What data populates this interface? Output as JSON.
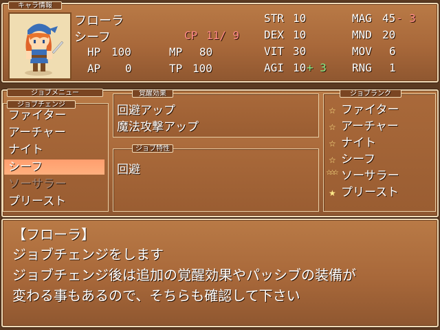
{
  "status": {
    "tab": "キャラ情報",
    "name": "フローラ",
    "job": "シーフ",
    "cp_label": "CP",
    "cp_value": "11/ 9",
    "hp_label": "HP",
    "hp": "100",
    "mp_label": "MP",
    "mp": "80",
    "ap_label": "AP",
    "ap": "0",
    "tp_label": "TP",
    "tp": "100",
    "str_label": "STR",
    "str": "10",
    "dex_label": "DEX",
    "dex": "10",
    "vit_label": "VIT",
    "vit": "30",
    "agi_label": "AGI",
    "agi": "10",
    "agi_bonus": "+ 3",
    "mag_label": "MAG",
    "mag": "45",
    "mag_bonus": "- 3",
    "mnd_label": "MND",
    "mnd": "20",
    "mov_label": "MOV",
    "mov": "6",
    "rng_label": "RNG",
    "rng": "1"
  },
  "job_menu": {
    "tab": "ジョブメニュー",
    "sub_tab": "ジョブチェンジ",
    "items": [
      "ファイター",
      "アーチャー",
      "ナイト",
      "シーフ",
      "ソーサラー",
      "プリースト"
    ],
    "selected_index": 3,
    "disabled_index": 4
  },
  "awakening": {
    "tab": "覚醒効果",
    "items": [
      "回避アップ",
      "魔法攻撃アップ"
    ]
  },
  "job_traits": {
    "tab": "ジョブ特性",
    "items": [
      "回避"
    ]
  },
  "job_rank": {
    "tab": "ジョブランク",
    "items": [
      {
        "label": "ファイター",
        "stars": "☆"
      },
      {
        "label": "アーチャー",
        "stars": "☆"
      },
      {
        "label": "ナイト",
        "stars": "☆"
      },
      {
        "label": "シーフ",
        "stars": "☆"
      },
      {
        "label": "ソーサラー",
        "stars": "☆☆☆"
      },
      {
        "label": "プリースト",
        "stars": "★"
      }
    ]
  },
  "message": {
    "speaker": "【フローラ】",
    "lines": [
      "ジョブチェンジをします",
      "ジョブチェンジ後は追加の覚醒効果やパッシブの装備が",
      "変わる事もあるので、そちらも確認して下さい"
    ]
  },
  "colors": {
    "window": "#a8683a",
    "border": "#f2dcb8",
    "selection": "#ffa574",
    "cp": "#ff8a8a",
    "bonus": "#8bf08b",
    "star": "#ffe98a"
  }
}
